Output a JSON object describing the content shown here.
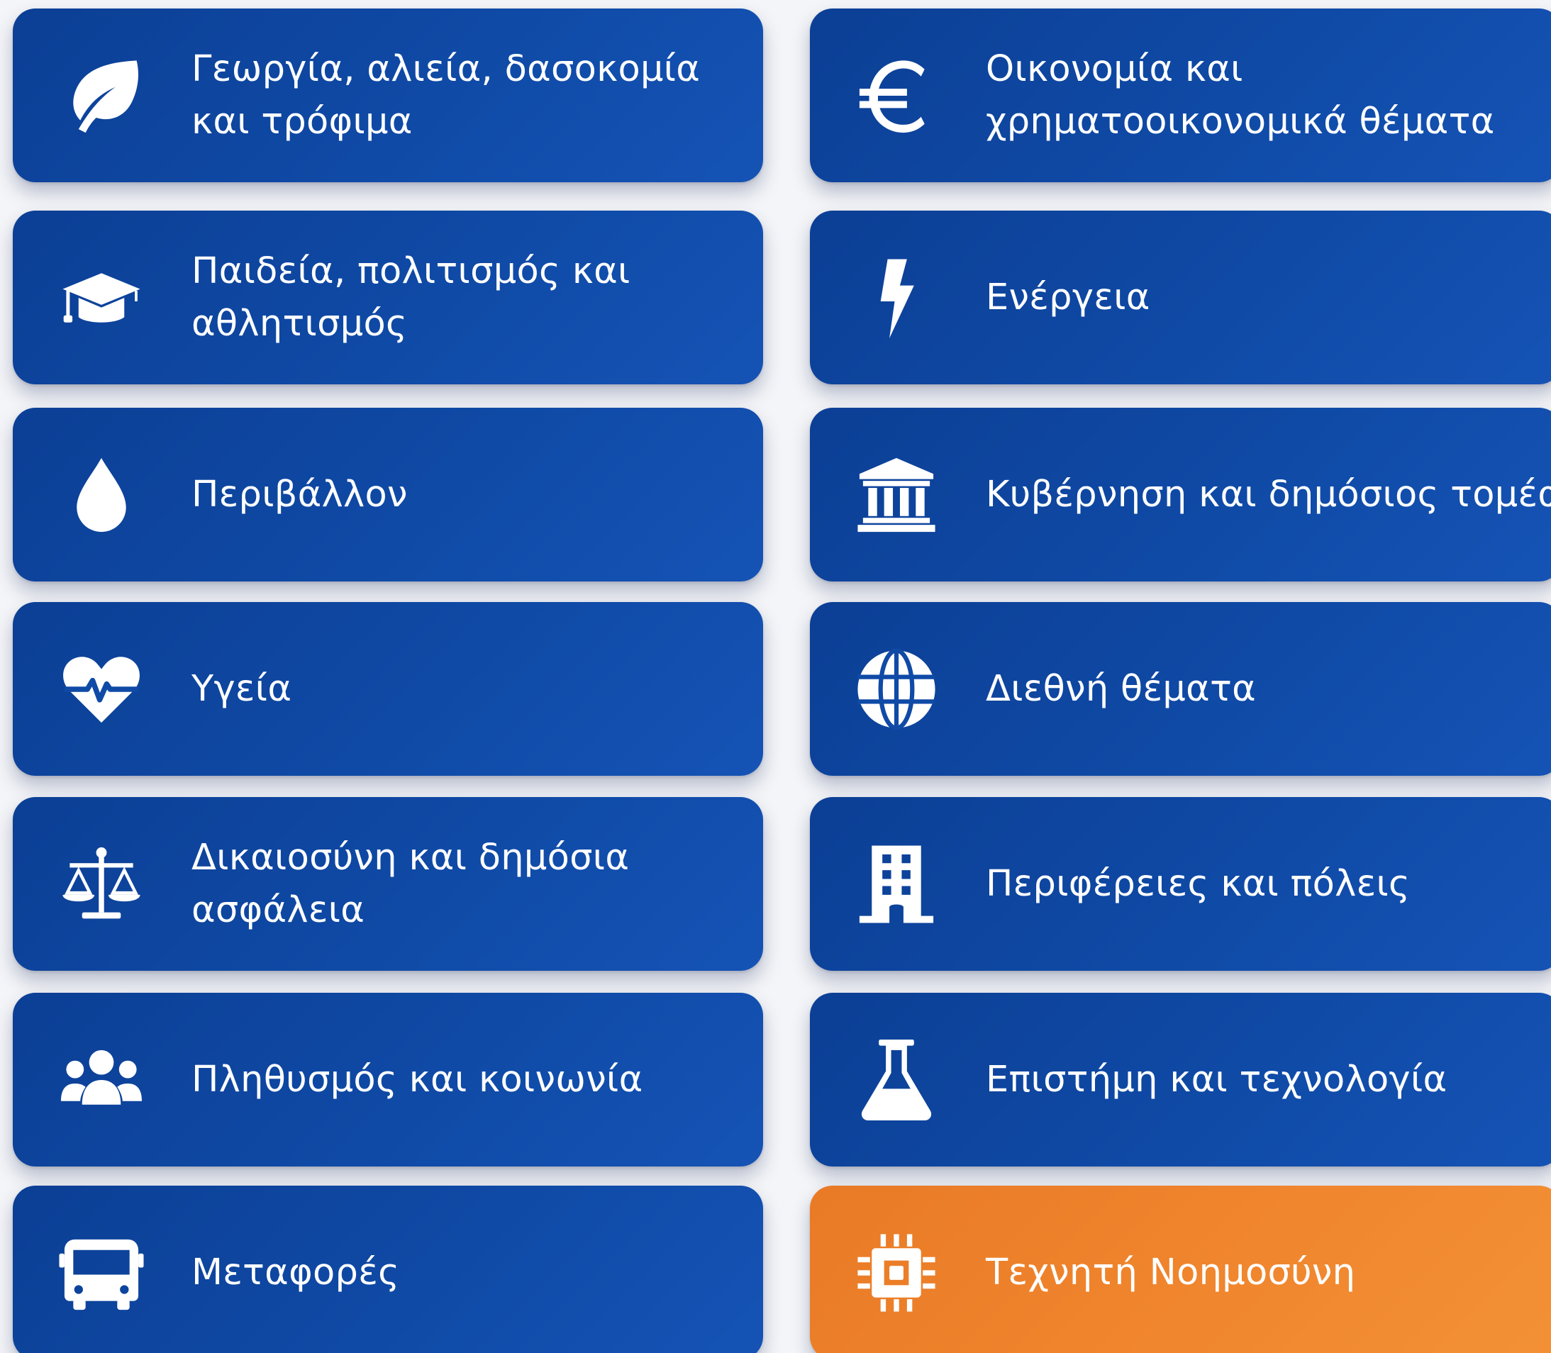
{
  "categories_left": [
    {
      "line1": "Γεωργία, αλιεία, δασοκομία",
      "line2": "και τρόφιμα",
      "icon": "leaf-icon"
    },
    {
      "line1": "Παιδεία, πολιτισμός και",
      "line2": "αθλητισμός",
      "icon": "graduation-cap-icon"
    },
    {
      "line1": "Περιβάλλον",
      "line2": "",
      "icon": "water-drop-icon"
    },
    {
      "line1": "Υγεία",
      "line2": "",
      "icon": "heartbeat-icon"
    },
    {
      "line1": "Δικαιοσύνη και δημόσια",
      "line2": "ασφάλεια",
      "icon": "scales-icon"
    },
    {
      "line1": "Πληθυσμός και κοινωνία",
      "line2": "",
      "icon": "people-icon"
    },
    {
      "line1": "Μεταφορές",
      "line2": "",
      "icon": "bus-icon"
    }
  ],
  "categories_right": [
    {
      "line1": "Οικονομία και",
      "line2": "χρηματοοικονομικά θέματα",
      "icon": "euro-icon"
    },
    {
      "line1": "Ενέργεια",
      "line2": "",
      "icon": "lightning-icon"
    },
    {
      "line1": "Κυβέρνηση και δημόσιος τομέας",
      "line2": "",
      "icon": "government-building-icon"
    },
    {
      "line1": "Διεθνή θέματα",
      "line2": "",
      "icon": "globe-icon"
    },
    {
      "line1": "Περιφέρειες και πόλεις",
      "line2": "",
      "icon": "office-building-icon"
    },
    {
      "line1": "Επιστήμη και τεχνολογία",
      "line2": "",
      "icon": "flask-icon"
    },
    {
      "line1": "Τεχνητή Νοημοσύνη",
      "line2": "",
      "icon": "chip-icon"
    }
  ],
  "colors": {
    "card_blue": "#0f4aa6",
    "card_orange": "#f0862e",
    "text": "#ffffff",
    "background": "#f4f5f8"
  }
}
